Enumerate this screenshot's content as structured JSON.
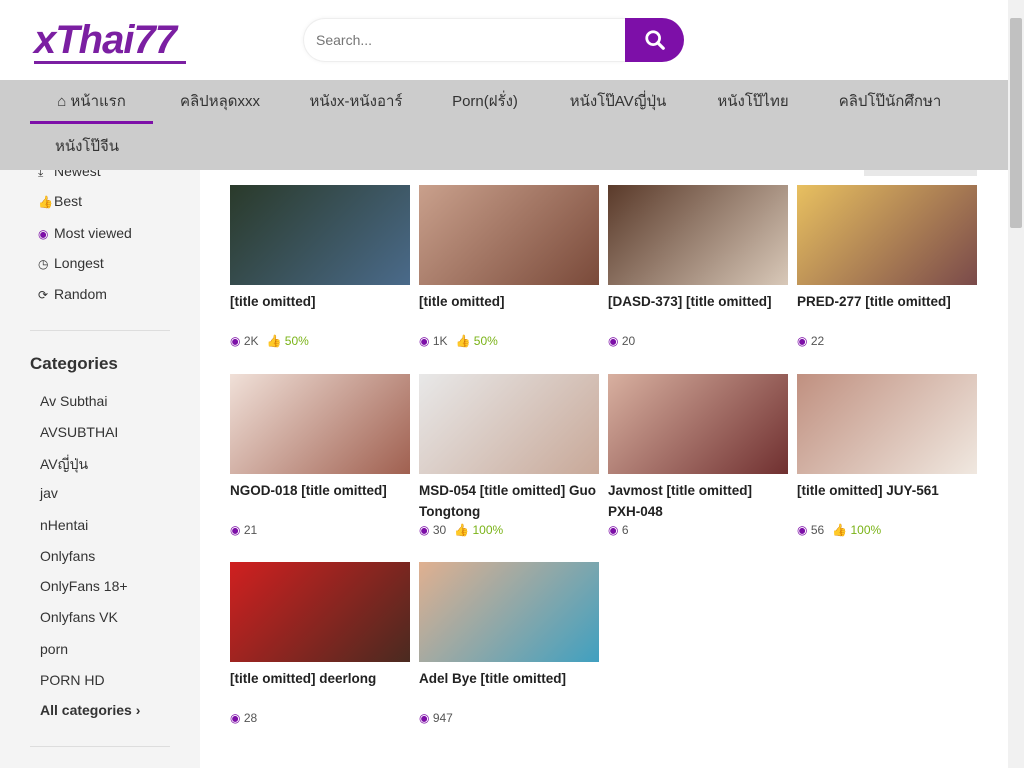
{
  "header": {
    "logo": "xThai77",
    "search_placeholder": "Search..."
  },
  "nav": [
    {
      "label": "หน้าแรก",
      "active": true
    },
    {
      "label": "คลิปหลุดxxx"
    },
    {
      "label": "หนังx-หนังอาร์"
    },
    {
      "label": "Porn(ฝรั่ง)"
    },
    {
      "label": "หนังโป๊AVญี่ปุ่น"
    },
    {
      "label": "หนังโป๊ไทย"
    },
    {
      "label": "คลิปโป๊นักศึกษา"
    },
    {
      "label": "หนังโป๊จีน"
    }
  ],
  "sidebar": {
    "sort": [
      "Newest",
      "Best",
      "Most viewed",
      "Longest",
      "Random"
    ],
    "categories_heading": "Categories",
    "categories": [
      "Av Subthai",
      "AVSUBTHAI",
      "AVญี่ปุ่น",
      "jav",
      "nHentai",
      "Onlyfans",
      "OnlyFans 18+",
      "Onlyfans VK",
      "porn",
      "PORN HD"
    ],
    "all_categories": "All categories"
  },
  "videos": [
    {
      "title": "[title omitted]",
      "views": "2K",
      "rating": "50%"
    },
    {
      "title": "[title omitted]",
      "views": "1K",
      "rating": "50%"
    },
    {
      "title": "[DASD-373] [title omitted]",
      "views": "20",
      "rating": ""
    },
    {
      "title": "PRED-277 [title omitted]",
      "views": "22",
      "rating": ""
    },
    {
      "title": "NGOD-018 [title omitted]",
      "views": "21",
      "rating": ""
    },
    {
      "title": "MSD-054 [title omitted] Guo Tongtong",
      "views": "30",
      "rating": "100%"
    },
    {
      "title": "Javmost [title omitted] PXH-048",
      "views": "6",
      "rating": ""
    },
    {
      "title": "[title omitted] JUY-561",
      "views": "56",
      "rating": "100%"
    },
    {
      "title": "[title omitted] deerlong",
      "views": "28",
      "rating": ""
    },
    {
      "title": "Adel Bye [title omitted]",
      "views": "947",
      "rating": ""
    }
  ]
}
